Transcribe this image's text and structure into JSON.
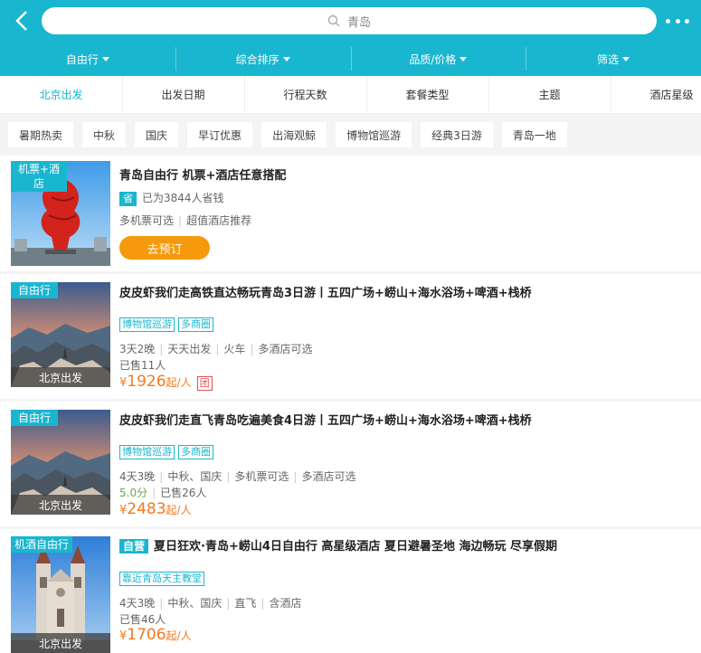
{
  "search": {
    "query": "青岛"
  },
  "filters": [
    {
      "label": "自由行"
    },
    {
      "label": "综合排序"
    },
    {
      "label": "品质/价格"
    },
    {
      "label": "筛选"
    }
  ],
  "tabs": [
    "北京出发",
    "出发日期",
    "行程天数",
    "套餐类型",
    "主题",
    "酒店星级"
  ],
  "chips": [
    "暑期热卖",
    "中秋",
    "国庆",
    "早订优惠",
    "出海观鲸",
    "博物馆巡游",
    "经典3日游",
    "青岛一地"
  ],
  "cards": [
    {
      "ribbon": "机票+酒店",
      "title": "青岛自由行 机票+酒店任意搭配",
      "badge": "省",
      "saved": "已为3844人省钱",
      "features": [
        "多机票可选",
        "超值酒店推荐"
      ],
      "button": "去预订"
    },
    {
      "ribbon": "自由行",
      "depart": "北京出发",
      "title": "皮皮虾我们走高铁直达畅玩青岛3日游丨五四广场+崂山+海水浴场+啤酒+栈桥",
      "tags": [
        "博物馆巡游",
        "多商圈"
      ],
      "features": [
        "3天2晚",
        "天天出发",
        "火车",
        "多酒店可选"
      ],
      "sold": "已售11人",
      "currency": "¥",
      "price": "1926",
      "price_suffix": "起/人",
      "group_badge": "团"
    },
    {
      "ribbon": "自由行",
      "depart": "北京出发",
      "title": "皮皮虾我们走直飞青岛吃遍美食4日游丨五四广场+崂山+海水浴场+啤酒+栈桥",
      "tags": [
        "博物馆巡游",
        "多商圈"
      ],
      "features": [
        "4天3晚",
        "中秋、国庆",
        "多机票可选",
        "多酒店可选"
      ],
      "score": "5.0分",
      "sold": "已售26人",
      "currency": "¥",
      "price": "2483",
      "price_suffix": "起/人"
    },
    {
      "ribbon": "机酒自由行",
      "depart": "北京出发",
      "self_badge": "自营",
      "title": "夏日狂欢·青岛+崂山4日自由行 高星级酒店 夏日避暑圣地 海边畅玩 尽享假期",
      "tags": [
        "靠近青岛天主教堂"
      ],
      "features": [
        "4天3晚",
        "中秋、国庆",
        "直飞",
        "含酒店"
      ],
      "sold": "已售46人",
      "currency": "¥",
      "price": "1706",
      "price_suffix": "起/人"
    }
  ],
  "colors": {
    "brand": "#19b6cf",
    "price": "#f47920",
    "button": "#f59a0c"
  }
}
